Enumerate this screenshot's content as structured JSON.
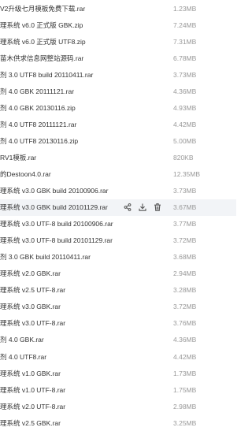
{
  "files": [
    {
      "name": "V2升级七月模板免费下载.rar",
      "size": "1.23MB"
    },
    {
      "name": "理系统 v6.0 正式版 GBK.zip",
      "size": "7.24MB"
    },
    {
      "name": "理系统 v6.0 正式版 UTF8.zip",
      "size": "7.31MB"
    },
    {
      "name": "苗木供求信息网整站源码.rar",
      "size": "6.78MB"
    },
    {
      "name": "剂 3.0 UTF8 build 20110411.rar",
      "size": "3.73MB"
    },
    {
      "name": "剂 4.0 GBK 20111121.rar",
      "size": "4.36MB"
    },
    {
      "name": "剂 4.0 GBK 20130116.zip",
      "size": "4.93MB"
    },
    {
      "name": "剂 4.0 UTF8 20111121.rar",
      "size": "4.42MB"
    },
    {
      "name": "剂 4.0 UTF8 20130116.zip",
      "size": "5.00MB"
    },
    {
      "name": "RV1模板.rar",
      "size": "820KB"
    },
    {
      "name": "的Destoon4.0.rar",
      "size": "12.35MB"
    },
    {
      "name": "理系统 v3.0 GBK build 20100906.rar",
      "size": "3.73MB"
    },
    {
      "name": "理系统 v3.0 GBK build 20101129.rar",
      "size": "3.67MB"
    },
    {
      "name": "理系统 v3.0 UTF-8 build 20100906.rar",
      "size": "3.77MB"
    },
    {
      "name": "理系统 v3.0 UTF-8 build 20101129.rar",
      "size": "3.72MB"
    },
    {
      "name": "剂 3.0 GBK build 20110411.rar",
      "size": "3.68MB"
    },
    {
      "name": "理系统 v2.0 GBK.rar",
      "size": "2.94MB"
    },
    {
      "name": "理系统 v2.5 UTF-8.rar",
      "size": "3.28MB"
    },
    {
      "name": "理系统 v3.0 GBK.rar",
      "size": "3.72MB"
    },
    {
      "name": "理系统 v3.0 UTF-8.rar",
      "size": "3.76MB"
    },
    {
      "name": "剂 4.0 GBK.rar",
      "size": "4.36MB"
    },
    {
      "name": "剂 4.0 UTF8.rar",
      "size": "4.42MB"
    },
    {
      "name": "理系统 v1.0 GBK.rar",
      "size": "1.73MB"
    },
    {
      "name": "理系统 v1.0 UTF-8.rar",
      "size": "1.75MB"
    },
    {
      "name": "理系统 v2.0 UTF-8.rar",
      "size": "2.98MB"
    },
    {
      "name": "理系统 v2.5 GBK.rar",
      "size": "3.25MB"
    }
  ],
  "highlighted_row": 12,
  "row_actions": [
    "share-icon",
    "download-icon",
    "delete-icon"
  ],
  "colors": {
    "name": "#333333",
    "size": "#999999",
    "highlight": "#f2f4f7",
    "icon": "#555555"
  }
}
